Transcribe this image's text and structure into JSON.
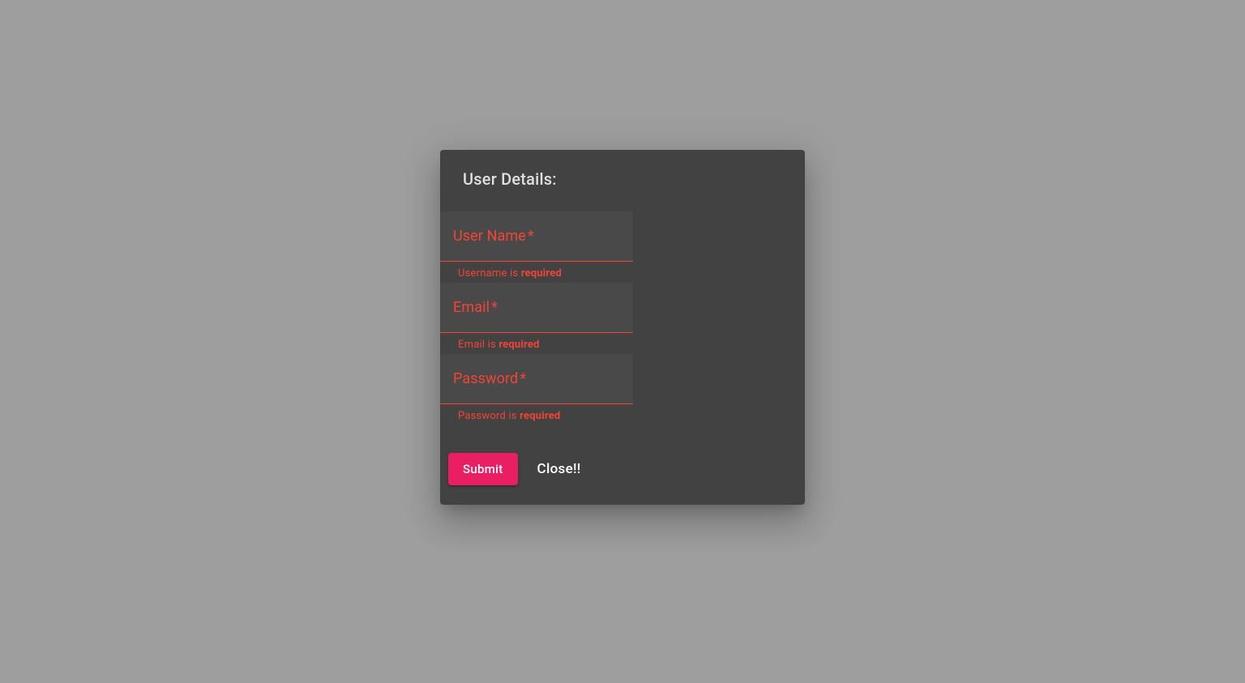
{
  "dialog": {
    "title": "User Details:"
  },
  "form": {
    "username": {
      "label": "User Name",
      "required_mark": "*",
      "value": "",
      "hint_prefix": "Username is ",
      "hint_strong": "required"
    },
    "email": {
      "label": "Email",
      "required_mark": "*",
      "value": "",
      "hint_prefix": "Email is ",
      "hint_strong": "required"
    },
    "password": {
      "label": "Password",
      "required_mark": "*",
      "value": "",
      "hint_prefix": "Password is ",
      "hint_strong": "required"
    }
  },
  "actions": {
    "submit": "Submit",
    "close": "Close!!"
  },
  "colors": {
    "background": "#9e9e9e",
    "dialog_bg": "#424242",
    "error": "#f44336",
    "accent": "#e91e63",
    "text_light": "#e0e0e0"
  }
}
